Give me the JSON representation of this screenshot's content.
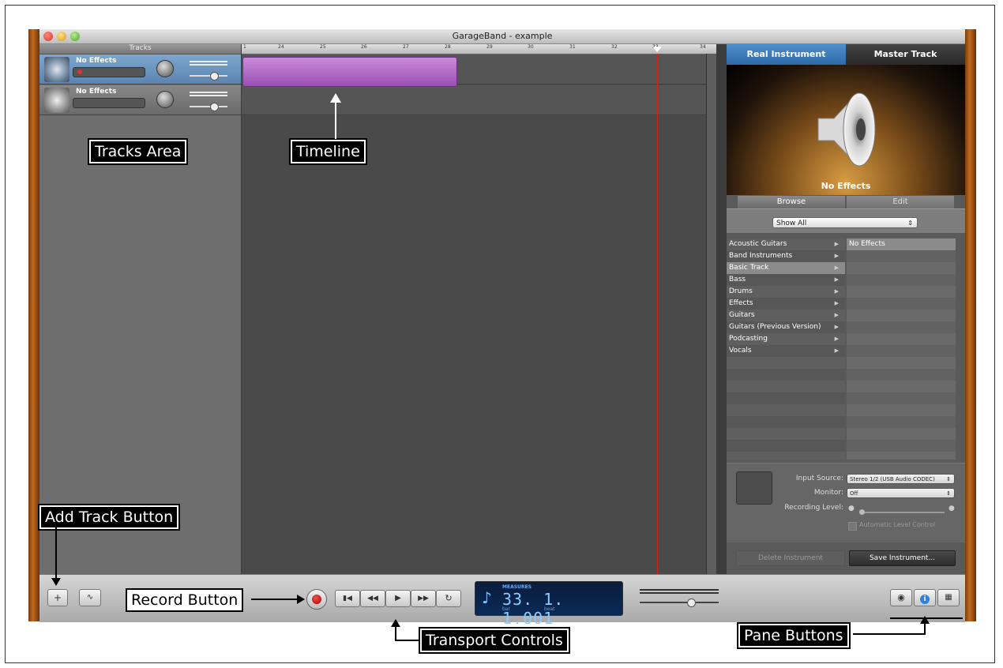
{
  "window": {
    "title": "GarageBand - example"
  },
  "tracks_panel": {
    "header": "Tracks",
    "tracks": [
      {
        "name": "No Effects",
        "selected": true
      },
      {
        "name": "No Effects",
        "selected": false
      }
    ]
  },
  "timeline": {
    "ruler_marks": [
      "1",
      "24",
      "25",
      "26",
      "27",
      "28",
      "29",
      "30",
      "31",
      "32",
      "33",
      "34"
    ]
  },
  "right_pane": {
    "tabs": [
      "Real Instrument",
      "Master Track"
    ],
    "instrument_name": "No Effects",
    "subtabs": [
      "Browse",
      "Edit"
    ],
    "filter": "Show All",
    "categories": [
      {
        "label": "Acoustic Guitars",
        "selected": false
      },
      {
        "label": "Band Instruments",
        "selected": false
      },
      {
        "label": "Basic Track",
        "selected": true
      },
      {
        "label": "Bass",
        "selected": false
      },
      {
        "label": "Drums",
        "selected": false
      },
      {
        "label": "Effects",
        "selected": false
      },
      {
        "label": "Guitars",
        "selected": false
      },
      {
        "label": "Guitars (Previous Version)",
        "selected": false
      },
      {
        "label": "Podcasting",
        "selected": false
      },
      {
        "label": "Vocals",
        "selected": false
      }
    ],
    "presets": [
      "No Effects"
    ],
    "settings": {
      "input_source_label": "Input Source:",
      "input_source_value": "Stereo 1/2 (USB Audio CODEC)",
      "monitor_label": "Monitor:",
      "monitor_value": "Off",
      "recording_level_label": "Recording Level:",
      "auto_level_label": "Automatic Level Control"
    },
    "delete_button": "Delete Instrument",
    "save_button": "Save Instrument..."
  },
  "transport": {
    "lcd_mode": "MEASURES",
    "lcd_value": "33. 1. 1.001",
    "lcd_bar_label": "bar",
    "lcd_beat_label": "beat"
  },
  "annotations": {
    "tracks_area": "Tracks Area",
    "timeline": "Timeline",
    "add_track": "Add Track Button",
    "record": "Record Button",
    "transport": "Transport Controls",
    "pane_buttons": "Pane Buttons"
  },
  "icons": {
    "add_track": "plus-icon",
    "track_info": "wave-icon",
    "rewind_start": "skip-back-icon",
    "rewind": "rewind-icon",
    "play": "play-icon",
    "forward": "fast-forward-icon",
    "cycle": "loop-icon",
    "loop_browser": "eye-icon",
    "info": "info-icon",
    "media": "media-icon"
  },
  "colors": {
    "accent_blue": "#2f6aa8",
    "region_purple": "#9b4fb4",
    "playhead_red": "#c8281e"
  }
}
